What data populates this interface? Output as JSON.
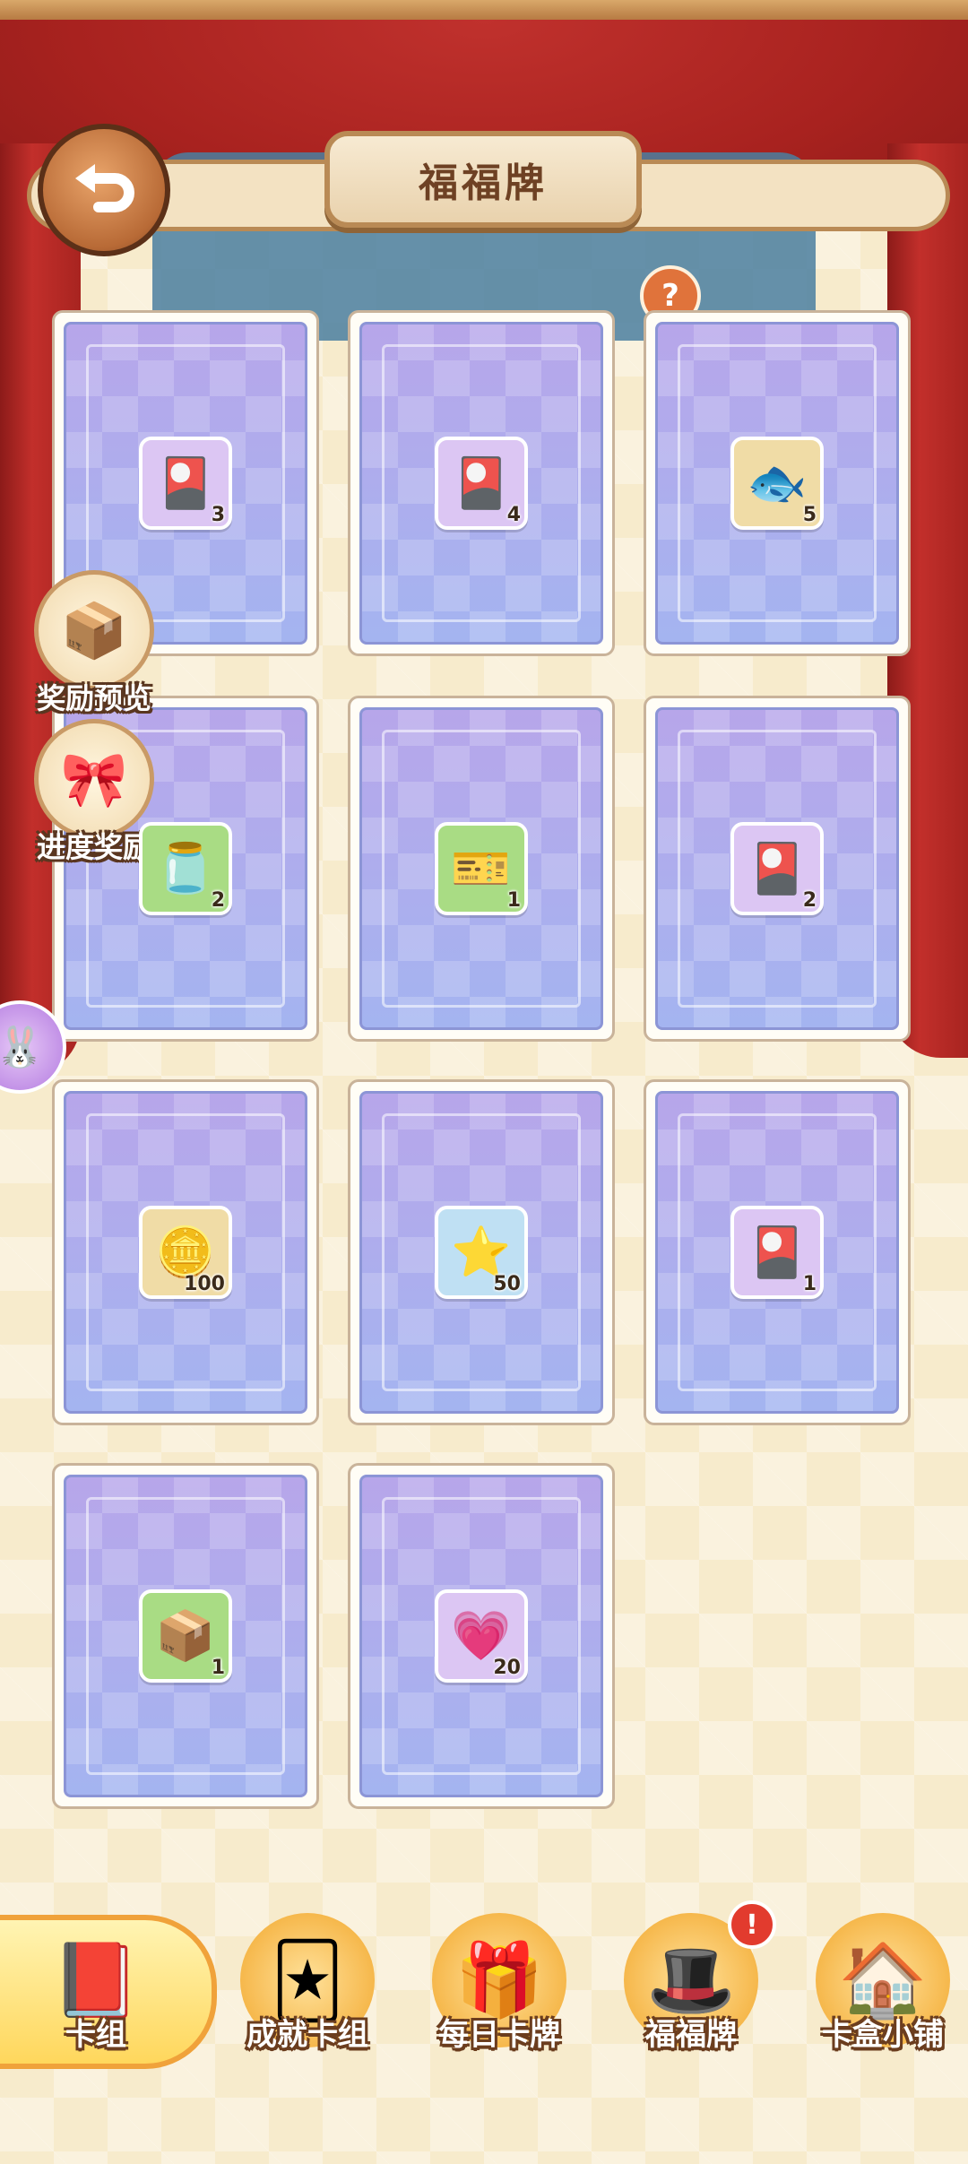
{
  "header": {
    "title": "福福牌",
    "back_icon": "back-arrow-icon",
    "help_label": "?"
  },
  "side_buttons": [
    {
      "label": "奖励预览",
      "icon": "mystery-box-icon"
    },
    {
      "label": "进度奖励",
      "icon": "gift-bow-icon"
    }
  ],
  "cards": [
    {
      "item": "green-card-pack-icon",
      "glyph": "🎴",
      "qty": "3",
      "bg": "bg-purple"
    },
    {
      "item": "green-card-pack-icon",
      "glyph": "🎴",
      "qty": "4",
      "bg": "bg-purple"
    },
    {
      "item": "fish-food-bag-icon",
      "glyph": "🐟",
      "qty": "5",
      "bg": "bg-gold"
    },
    {
      "item": "herb-jar-icon",
      "glyph": "🫙",
      "qty": "2",
      "bg": "bg-green"
    },
    {
      "item": "coral-ticket-icon",
      "glyph": "🎫",
      "qty": "1",
      "bg": "bg-green"
    },
    {
      "item": "purple-card-pack-icon",
      "glyph": "🎴",
      "qty": "2",
      "bg": "bg-purple"
    },
    {
      "item": "bunny-coin-icon",
      "glyph": "🪙",
      "qty": "100",
      "bg": "bg-gold"
    },
    {
      "item": "star-gem-icon",
      "glyph": "⭐",
      "qty": "50",
      "bg": "bg-blue"
    },
    {
      "item": "red-card-pack-icon",
      "glyph": "🎴",
      "qty": "1",
      "bg": "bg-purple"
    },
    {
      "item": "gift-box-icon",
      "glyph": "📦",
      "qty": "1",
      "bg": "bg-green"
    },
    {
      "item": "pink-heart-icon",
      "glyph": "💗",
      "qty": "20",
      "bg": "bg-purple"
    }
  ],
  "bottom_nav": [
    {
      "label": "卡组",
      "icon": "card-book-icon",
      "glyph": "📕",
      "active": true
    },
    {
      "label": "成就卡组",
      "icon": "achievement-cards-icon",
      "glyph": "🃏"
    },
    {
      "label": "每日卡牌",
      "icon": "daily-gift-icon",
      "glyph": "🎁"
    },
    {
      "label": "福福牌",
      "icon": "magic-hat-bunny-icon",
      "glyph": "🎩",
      "badge": "!"
    },
    {
      "label": "卡盒小铺",
      "icon": "card-shop-house-icon",
      "glyph": "🏠"
    }
  ],
  "floating": {
    "icon": "bunny-bubble-icon"
  },
  "colors": {
    "card_back": "#a9b1ef",
    "accent": "#f6b84c",
    "curtain": "#a8221f"
  }
}
